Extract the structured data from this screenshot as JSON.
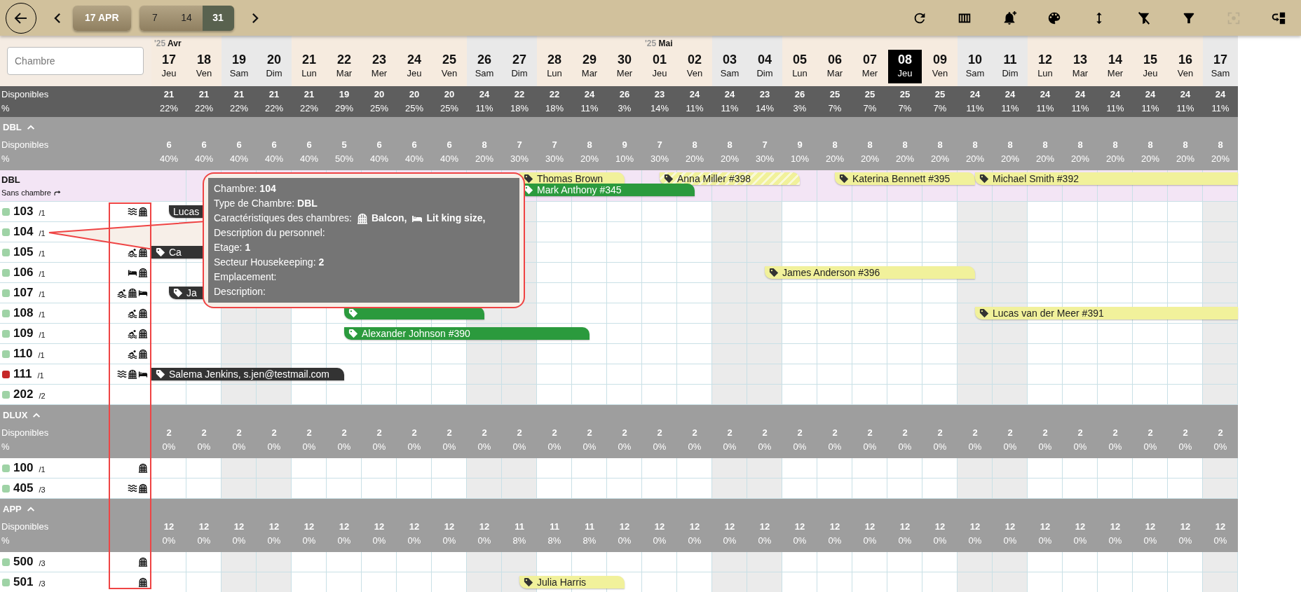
{
  "toolbar": {
    "date_button": "17 APR",
    "ranges": [
      {
        "label": "7",
        "selected": false
      },
      {
        "label": "14",
        "selected": false
      },
      {
        "label": "31",
        "selected": true
      }
    ],
    "tools": [
      {
        "kind": "refresh",
        "disabled": false
      },
      {
        "kind": "columns",
        "disabled": false
      },
      {
        "kind": "bell-plus",
        "disabled": false
      },
      {
        "kind": "palette",
        "disabled": false
      },
      {
        "kind": "height",
        "disabled": false
      },
      {
        "kind": "filter-off",
        "disabled": false
      },
      {
        "kind": "filter",
        "disabled": false
      },
      {
        "kind": "focus",
        "disabled": true
      },
      {
        "kind": "switch",
        "disabled": false
      }
    ]
  },
  "search": {
    "placeholder": "Chambre"
  },
  "days": [
    {
      "month_year": "'25",
      "month": "Avr",
      "day": "17",
      "weekday": "Jeu",
      "weekend": false,
      "today": false
    },
    {
      "day": "18",
      "weekday": "Ven",
      "weekend": false,
      "today": false
    },
    {
      "day": "19",
      "weekday": "Sam",
      "weekend": true,
      "today": false
    },
    {
      "day": "20",
      "weekday": "Dim",
      "weekend": true,
      "today": false
    },
    {
      "day": "21",
      "weekday": "Lun",
      "weekend": false,
      "today": false
    },
    {
      "day": "22",
      "weekday": "Mar",
      "weekend": false,
      "today": false
    },
    {
      "day": "23",
      "weekday": "Mer",
      "weekend": false,
      "today": false
    },
    {
      "day": "24",
      "weekday": "Jeu",
      "weekend": false,
      "today": false
    },
    {
      "day": "25",
      "weekday": "Ven",
      "weekend": false,
      "today": false
    },
    {
      "day": "26",
      "weekday": "Sam",
      "weekend": true,
      "today": false
    },
    {
      "day": "27",
      "weekday": "Dim",
      "weekend": true,
      "today": false
    },
    {
      "day": "28",
      "weekday": "Lun",
      "weekend": false,
      "today": false
    },
    {
      "day": "29",
      "weekday": "Mar",
      "weekend": false,
      "today": false
    },
    {
      "day": "30",
      "weekday": "Mer",
      "weekend": false,
      "today": false
    },
    {
      "month_year": "'25",
      "month": "Mai",
      "day": "01",
      "weekday": "Jeu",
      "weekend": false,
      "today": false
    },
    {
      "day": "02",
      "weekday": "Ven",
      "weekend": false,
      "today": false
    },
    {
      "day": "03",
      "weekday": "Sam",
      "weekend": true,
      "today": false
    },
    {
      "day": "04",
      "weekday": "Dim",
      "weekend": true,
      "today": false
    },
    {
      "day": "05",
      "weekday": "Lun",
      "weekend": false,
      "today": false
    },
    {
      "day": "06",
      "weekday": "Mar",
      "weekend": false,
      "today": false
    },
    {
      "day": "07",
      "weekday": "Mer",
      "weekend": false,
      "today": false
    },
    {
      "day": "08",
      "weekday": "Jeu",
      "weekend": false,
      "today": true
    },
    {
      "day": "09",
      "weekday": "Ven",
      "weekend": false,
      "today": false
    },
    {
      "day": "10",
      "weekday": "Sam",
      "weekend": true,
      "today": false
    },
    {
      "day": "11",
      "weekday": "Dim",
      "weekend": true,
      "today": false
    },
    {
      "day": "12",
      "weekday": "Lun",
      "weekend": false,
      "today": false
    },
    {
      "day": "13",
      "weekday": "Mar",
      "weekend": false,
      "today": false
    },
    {
      "day": "14",
      "weekday": "Mer",
      "weekend": false,
      "today": false
    },
    {
      "day": "15",
      "weekday": "Jeu",
      "weekend": false,
      "today": false
    },
    {
      "day": "16",
      "weekday": "Ven",
      "weekend": false,
      "today": false
    },
    {
      "day": "17",
      "weekday": "Sam",
      "weekend": true,
      "today": false
    }
  ],
  "totals": {
    "label": "Disponibles",
    "percent_label": "%",
    "counts": [
      "21",
      "21",
      "21",
      "21",
      "21",
      "19",
      "20",
      "20",
      "20",
      "24",
      "22",
      "22",
      "24",
      "26",
      "23",
      "24",
      "24",
      "23",
      "26",
      "25",
      "25",
      "25",
      "25",
      "24",
      "24",
      "24",
      "24",
      "24",
      "24",
      "24",
      "24"
    ],
    "percents": [
      "22%",
      "22%",
      "22%",
      "22%",
      "22%",
      "29%",
      "25%",
      "25%",
      "25%",
      "11%",
      "18%",
      "18%",
      "11%",
      "3%",
      "14%",
      "11%",
      "11%",
      "14%",
      "3%",
      "7%",
      "7%",
      "7%",
      "7%",
      "11%",
      "11%",
      "11%",
      "11%",
      "11%",
      "11%",
      "11%",
      "11%"
    ]
  },
  "groups": [
    {
      "name": "DBL",
      "expanded": true,
      "label": "Disponibles",
      "percent_label": "%",
      "counts": [
        "6",
        "6",
        "6",
        "6",
        "6",
        "5",
        "6",
        "6",
        "6",
        "8",
        "7",
        "7",
        "8",
        "9",
        "7",
        "8",
        "8",
        "7",
        "9",
        "8",
        "8",
        "8",
        "8",
        "8",
        "8",
        "8",
        "8",
        "8",
        "8",
        "8",
        "8"
      ],
      "percents": [
        "40%",
        "40%",
        "40%",
        "40%",
        "40%",
        "50%",
        "40%",
        "40%",
        "40%",
        "20%",
        "30%",
        "30%",
        "20%",
        "10%",
        "30%",
        "20%",
        "20%",
        "30%",
        "10%",
        "20%",
        "20%",
        "20%",
        "20%",
        "20%",
        "20%",
        "20%",
        "20%",
        "20%",
        "20%",
        "20%",
        "20%"
      ],
      "unassigned": {
        "title": "DBL",
        "subtitle": "Sans chambre",
        "bookings": [
          {
            "guest": "Thomas Brown",
            "color": "#f1f19b",
            "tag": true,
            "hatched": false,
            "lower": false
          },
          {
            "guest": "Mark Anthony #345",
            "color": "#2b9a3d",
            "tag": true,
            "hatched": false,
            "lower": true
          },
          {
            "guest": "Anna Miller #398",
            "color": "#f1f19b",
            "tag": true,
            "hatched": true,
            "lower": false
          },
          {
            "guest": "Katerina Bennett #395",
            "color": "#f1f19b",
            "tag": true,
            "hatched": false,
            "lower": false
          },
          {
            "guest": "Michael Smith #392",
            "color": "#f1f19b",
            "tag": true,
            "hatched": false,
            "lower": false
          }
        ]
      },
      "rooms": [
        {
          "number": "103",
          "capacity": "/1",
          "color": "#9fd3a6",
          "features": [
            {
              "kind": "waves"
            },
            {
              "kind": "balcony"
            }
          ],
          "bookings": [
            {
              "guest": "Lucas",
              "color": "#333333",
              "tag": false
            }
          ]
        },
        {
          "number": "104",
          "capacity": "/1",
          "color": "#9fd3a6"
        },
        {
          "number": "105",
          "capacity": "/1",
          "color": "#9fd3a6",
          "features": [
            {
              "kind": "pool"
            },
            {
              "kind": "balcony"
            }
          ],
          "bookings": [
            {
              "guest": "Ca",
              "color": "#333333",
              "tag": true
            }
          ]
        },
        {
          "number": "106",
          "capacity": "/1",
          "color": "#9fd3a6",
          "features": [
            {
              "kind": "bed"
            },
            {
              "kind": "balcony"
            }
          ],
          "bookings": [
            {
              "guest": "James Anderson #396",
              "color": "#f1f19b",
              "tag": true
            }
          ]
        },
        {
          "number": "107",
          "capacity": "/1",
          "color": "#9fd3a6",
          "features": [
            {
              "kind": "pool"
            },
            {
              "kind": "balcony"
            },
            {
              "kind": "bed"
            }
          ],
          "bookings": [
            {
              "guest": "Ja",
              "color": "#333333",
              "tag": true
            }
          ]
        },
        {
          "number": "108",
          "capacity": "/1",
          "color": "#9fd3a6",
          "features": [
            {
              "kind": "pool"
            },
            {
              "kind": "balcony"
            }
          ],
          "bookings": [
            {
              "color": "#2b9a3d",
              "tag": true
            },
            {
              "guest": "Lucas van der Meer #391",
              "color": "#f1f19b",
              "tag": true
            }
          ]
        },
        {
          "number": "109",
          "capacity": "/1",
          "color": "#9fd3a6",
          "features": [
            {
              "kind": "pool"
            },
            {
              "kind": "balcony"
            }
          ],
          "bookings": [
            {
              "guest": "Alexander Johnson #390",
              "color": "#2b9a3d",
              "tag": true
            }
          ]
        },
        {
          "number": "110",
          "capacity": "/1",
          "color": "#9fd3a6",
          "features": [
            {
              "kind": "pool"
            },
            {
              "kind": "balcony"
            }
          ]
        },
        {
          "number": "111",
          "capacity": "/1",
          "color": "#c62828",
          "features": [
            {
              "kind": "waves"
            },
            {
              "kind": "balcony"
            },
            {
              "kind": "bed"
            }
          ],
          "bookings": [
            {
              "guest": "Salema Jenkins, s.jen@testmail.com",
              "color": "#333333",
              "tag": true
            }
          ]
        },
        {
          "number": "202",
          "capacity": "/2",
          "color": "#9fd3a6"
        }
      ]
    },
    {
      "name": "DLUX",
      "expanded": true,
      "label": "Disponibles",
      "percent_label": "%",
      "counts": [
        "2",
        "2",
        "2",
        "2",
        "2",
        "2",
        "2",
        "2",
        "2",
        "2",
        "2",
        "2",
        "2",
        "2",
        "2",
        "2",
        "2",
        "2",
        "2",
        "2",
        "2",
        "2",
        "2",
        "2",
        "2",
        "2",
        "2",
        "2",
        "2",
        "2",
        "2"
      ],
      "percents": [
        "0%",
        "0%",
        "0%",
        "0%",
        "0%",
        "0%",
        "0%",
        "0%",
        "0%",
        "0%",
        "0%",
        "0%",
        "0%",
        "0%",
        "0%",
        "0%",
        "0%",
        "0%",
        "0%",
        "0%",
        "0%",
        "0%",
        "0%",
        "0%",
        "0%",
        "0%",
        "0%",
        "0%",
        "0%",
        "0%",
        "0%"
      ],
      "rooms": [
        {
          "number": "100",
          "capacity": "/1",
          "color": "#9fd3a6",
          "features": [
            {
              "kind": "balcony"
            }
          ]
        },
        {
          "number": "405",
          "capacity": "/3",
          "color": "#9fd3a6",
          "features": [
            {
              "kind": "waves"
            },
            {
              "kind": "balcony"
            }
          ]
        }
      ]
    },
    {
      "name": "APP",
      "expanded": true,
      "label": "Disponibles",
      "percent_label": "%",
      "counts": [
        "12",
        "12",
        "12",
        "12",
        "12",
        "12",
        "12",
        "12",
        "12",
        "12",
        "11",
        "11",
        "11",
        "12",
        "12",
        "12",
        "12",
        "12",
        "12",
        "12",
        "12",
        "12",
        "12",
        "12",
        "12",
        "12",
        "12",
        "12",
        "12",
        "12",
        "12"
      ],
      "percents": [
        "0%",
        "0%",
        "0%",
        "0%",
        "0%",
        "0%",
        "0%",
        "0%",
        "0%",
        "0%",
        "8%",
        "8%",
        "8%",
        "0%",
        "0%",
        "0%",
        "0%",
        "0%",
        "0%",
        "0%",
        "0%",
        "0%",
        "0%",
        "0%",
        "0%",
        "0%",
        "0%",
        "0%",
        "0%",
        "0%",
        "0%"
      ],
      "rooms": [
        {
          "number": "500",
          "capacity": "/3",
          "color": "#9fd3a6",
          "features": [
            {
              "kind": "balcony"
            }
          ]
        },
        {
          "number": "501",
          "capacity": "/3",
          "color": "#9fd3a6",
          "features": [
            {
              "kind": "balcony"
            }
          ],
          "bookings": [
            {
              "guest": "Julia Harris",
              "color": "#f1f19b",
              "tag": true
            }
          ]
        }
      ]
    }
  ],
  "tooltip": {
    "lines": [
      {
        "label": "Chambre:",
        "value": "104"
      },
      {
        "label": "Type de Chambre:",
        "value": "DBL"
      },
      {
        "label": "Caractéristiques des chambres:",
        "features": [
          {
            "kind": "balcony",
            "text": "Balcon,"
          },
          {
            "kind": "bed",
            "text": "Lit king size,"
          }
        ]
      },
      {
        "label": "Description du personnel:"
      },
      {
        "label": "Etage:",
        "value": "1"
      },
      {
        "label": "Secteur Housekeeping:",
        "value": "2"
      },
      {
        "label": "Emplacement:"
      },
      {
        "label": "Description:"
      }
    ]
  }
}
